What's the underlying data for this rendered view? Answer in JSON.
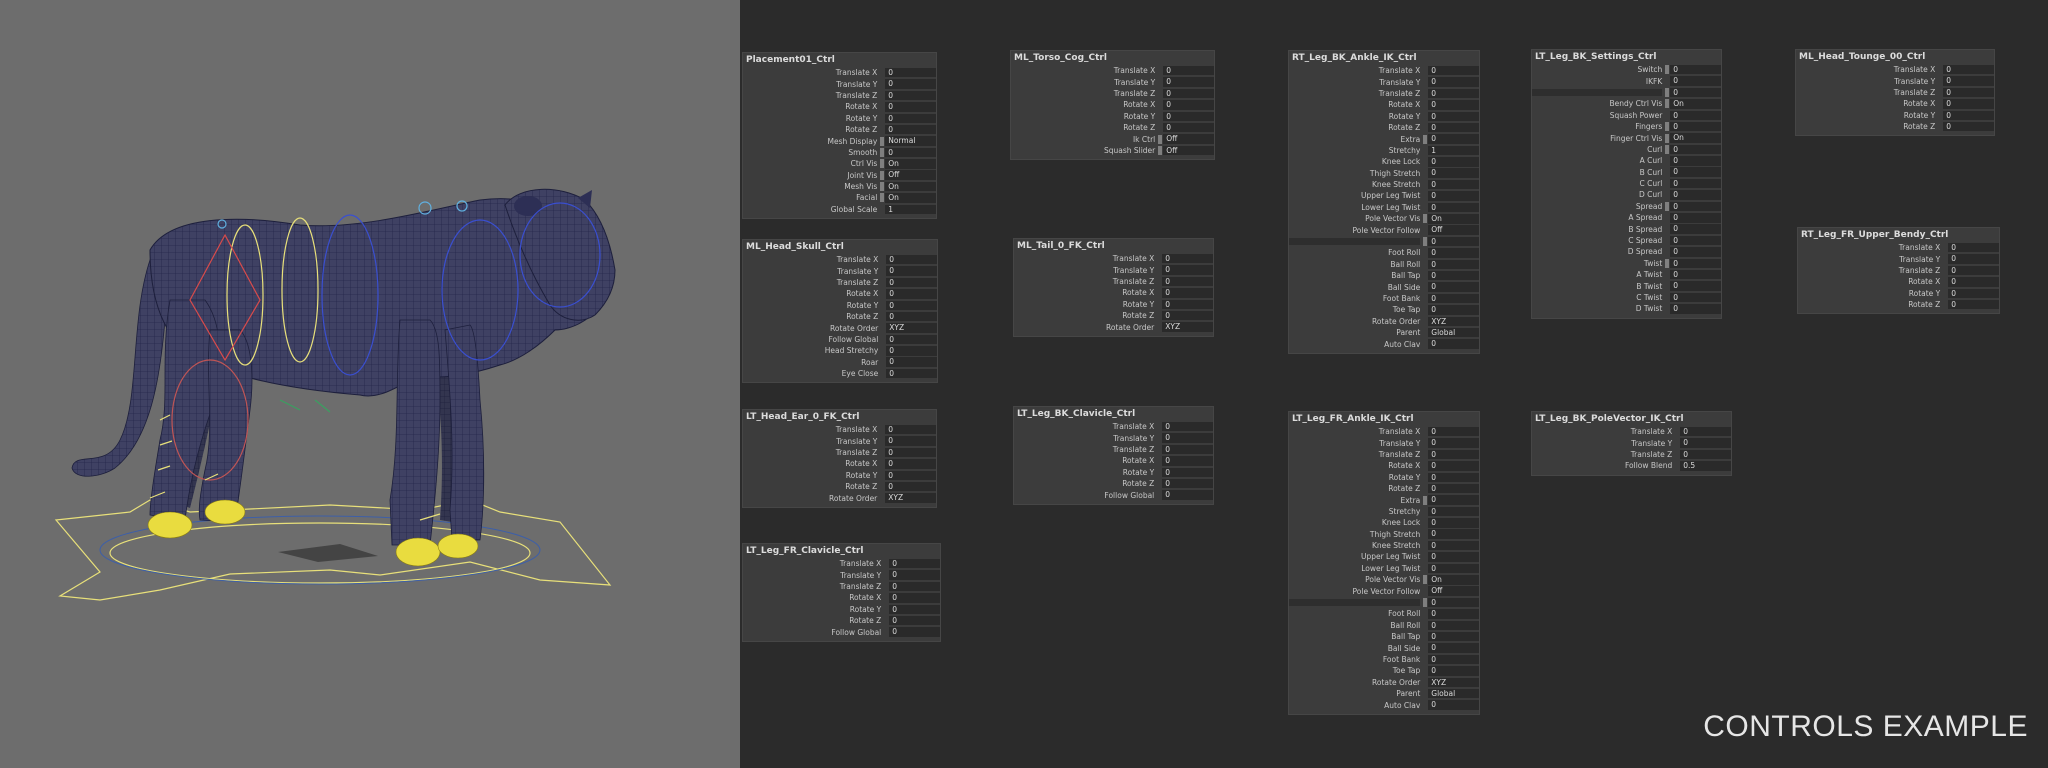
{
  "caption": "CONTROLS EXAMPLE",
  "boxes": {
    "placement": {
      "title": "Placement01_Ctrl",
      "rows": [
        {
          "label": "Translate X",
          "value": "0"
        },
        {
          "label": "Translate Y",
          "value": "0"
        },
        {
          "label": "Translate Z",
          "value": "0"
        },
        {
          "label": "Rotate X",
          "value": "0"
        },
        {
          "label": "Rotate Y",
          "value": "0"
        },
        {
          "label": "Rotate Z",
          "value": "0"
        },
        {
          "label": "Mesh Display",
          "value": "Normal"
        },
        {
          "label": "Smooth",
          "value": "0"
        },
        {
          "label": "Ctrl Vis",
          "value": "On"
        },
        {
          "label": "Joint Vis",
          "value": "Off"
        },
        {
          "label": "Mesh Vis",
          "value": "On"
        },
        {
          "label": "Facial",
          "value": "On"
        },
        {
          "label": "Global Scale",
          "value": "1"
        }
      ]
    },
    "torso_cog": {
      "title": "ML_Torso_Cog_Ctrl",
      "rows": [
        {
          "label": "Translate X",
          "value": "0"
        },
        {
          "label": "Translate Y",
          "value": "0"
        },
        {
          "label": "Translate Z",
          "value": "0"
        },
        {
          "label": "Rotate X",
          "value": "0"
        },
        {
          "label": "Rotate Y",
          "value": "0"
        },
        {
          "label": "Rotate Z",
          "value": "0"
        },
        {
          "label": "Ik Ctrl",
          "value": "Off"
        },
        {
          "label": "Squash Slider",
          "value": "Off"
        }
      ]
    },
    "rt_leg_bk_ankle": {
      "title": "RT_Leg_BK_Ankle_IK_Ctrl",
      "rows": [
        {
          "label": "Translate X",
          "value": "0"
        },
        {
          "label": "Translate Y",
          "value": "0"
        },
        {
          "label": "Translate Z",
          "value": "0"
        },
        {
          "label": "Rotate X",
          "value": "0"
        },
        {
          "label": "Rotate Y",
          "value": "0"
        },
        {
          "label": "Rotate Z",
          "value": "0"
        },
        {
          "label": "Extra",
          "value": "0"
        },
        {
          "label": "Stretchy",
          "value": "1"
        },
        {
          "label": "Knee Lock",
          "value": "0"
        },
        {
          "label": "Thigh Stretch",
          "value": "0"
        },
        {
          "label": "Knee Stretch",
          "value": "0"
        },
        {
          "label": "Upper Leg Twist",
          "value": "0"
        },
        {
          "label": "Lower Leg Twist",
          "value": "0"
        },
        {
          "label": "Pole Vector Vis",
          "value": "On"
        },
        {
          "label": "Pole Vector Follow",
          "value": "Off"
        },
        {
          "label": "",
          "value": "0"
        },
        {
          "label": "Foot Roll",
          "value": "0"
        },
        {
          "label": "Ball Roll",
          "value": "0"
        },
        {
          "label": "Ball Tap",
          "value": "0"
        },
        {
          "label": "Ball Side",
          "value": "0"
        },
        {
          "label": "Foot Bank",
          "value": "0"
        },
        {
          "label": "Toe Tap",
          "value": "0"
        },
        {
          "label": "Rotate Order",
          "value": "XYZ"
        },
        {
          "label": "Parent",
          "value": "Global"
        },
        {
          "label": "Auto Clav",
          "value": "0"
        }
      ]
    },
    "lt_leg_bk_settings": {
      "title": "LT_Leg_BK_Settings_Ctrl",
      "rows": [
        {
          "label": "Switch",
          "value": "0"
        },
        {
          "label": "IKFK",
          "value": "0"
        },
        {
          "label": "",
          "value": "0"
        },
        {
          "label": "Bendy Ctrl Vis",
          "value": "On"
        },
        {
          "label": "Squash Power",
          "value": "0"
        },
        {
          "label": "Fingers",
          "value": "0"
        },
        {
          "label": "Finger Ctrl Vis",
          "value": "On"
        },
        {
          "label": "Curl",
          "value": "0"
        },
        {
          "label": "A Curl",
          "value": "0"
        },
        {
          "label": "B Curl",
          "value": "0"
        },
        {
          "label": "C Curl",
          "value": "0"
        },
        {
          "label": "D Curl",
          "value": "0"
        },
        {
          "label": "Spread",
          "value": "0"
        },
        {
          "label": "A Spread",
          "value": "0"
        },
        {
          "label": "B Spread",
          "value": "0"
        },
        {
          "label": "C Spread",
          "value": "0"
        },
        {
          "label": "D Spread",
          "value": "0"
        },
        {
          "label": "Twist",
          "value": "0"
        },
        {
          "label": "A Twist",
          "value": "0"
        },
        {
          "label": "B Twist",
          "value": "0"
        },
        {
          "label": "C Twist",
          "value": "0"
        },
        {
          "label": "D Twist",
          "value": "0"
        }
      ]
    },
    "head_tounge": {
      "title": "ML_Head_Tounge_00_Ctrl",
      "rows": [
        {
          "label": "Translate X",
          "value": "0"
        },
        {
          "label": "Translate Y",
          "value": "0"
        },
        {
          "label": "Translate Z",
          "value": "0"
        },
        {
          "label": "Rotate X",
          "value": "0"
        },
        {
          "label": "Rotate Y",
          "value": "0"
        },
        {
          "label": "Rotate Z",
          "value": "0"
        }
      ]
    },
    "head_skull": {
      "title": "ML_Head_Skull_Ctrl",
      "rows": [
        {
          "label": "Translate X",
          "value": "0"
        },
        {
          "label": "Translate Y",
          "value": "0"
        },
        {
          "label": "Translate Z",
          "value": "0"
        },
        {
          "label": "Rotate X",
          "value": "0"
        },
        {
          "label": "Rotate Y",
          "value": "0"
        },
        {
          "label": "Rotate Z",
          "value": "0"
        },
        {
          "label": "Rotate Order",
          "value": "XYZ"
        },
        {
          "label": "Follow Global",
          "value": "0"
        },
        {
          "label": "Head Stretchy",
          "value": "0"
        },
        {
          "label": "Roar",
          "value": "0"
        },
        {
          "label": "Eye Close",
          "value": "0"
        }
      ]
    },
    "tail_fk": {
      "title": "ML_Tail_0_FK_Ctrl",
      "rows": [
        {
          "label": "Translate X",
          "value": "0"
        },
        {
          "label": "Translate Y",
          "value": "0"
        },
        {
          "label": "Translate Z",
          "value": "0"
        },
        {
          "label": "Rotate X",
          "value": "0"
        },
        {
          "label": "Rotate Y",
          "value": "0"
        },
        {
          "label": "Rotate Z",
          "value": "0"
        },
        {
          "label": "Rotate Order",
          "value": "XYZ"
        }
      ]
    },
    "rt_leg_fr_upper_bendy": {
      "title": "RT_Leg_FR_Upper_Bendy_Ctrl",
      "rows": [
        {
          "label": "Translate X",
          "value": "0"
        },
        {
          "label": "Translate Y",
          "value": "0"
        },
        {
          "label": "Translate Z",
          "value": "0"
        },
        {
          "label": "Rotate X",
          "value": "0"
        },
        {
          "label": "Rotate Y",
          "value": "0"
        },
        {
          "label": "Rotate Z",
          "value": "0"
        }
      ]
    },
    "lt_head_ear": {
      "title": "LT_Head_Ear_0_FK_Ctrl",
      "rows": [
        {
          "label": "Translate X",
          "value": "0"
        },
        {
          "label": "Translate Y",
          "value": "0"
        },
        {
          "label": "Translate Z",
          "value": "0"
        },
        {
          "label": "Rotate X",
          "value": "0"
        },
        {
          "label": "Rotate Y",
          "value": "0"
        },
        {
          "label": "Rotate Z",
          "value": "0"
        },
        {
          "label": "Rotate Order",
          "value": "XYZ"
        }
      ]
    },
    "lt_leg_bk_clavicle": {
      "title": "LT_Leg_BK_Clavicle_Ctrl",
      "rows": [
        {
          "label": "Translate X",
          "value": "0"
        },
        {
          "label": "Translate Y",
          "value": "0"
        },
        {
          "label": "Translate Z",
          "value": "0"
        },
        {
          "label": "Rotate X",
          "value": "0"
        },
        {
          "label": "Rotate Y",
          "value": "0"
        },
        {
          "label": "Rotate Z",
          "value": "0"
        },
        {
          "label": "Follow Global",
          "value": "0"
        }
      ]
    },
    "lt_leg_fr_ankle": {
      "title": "LT_Leg_FR_Ankle_IK_Ctrl",
      "rows": [
        {
          "label": "Translate X",
          "value": "0"
        },
        {
          "label": "Translate Y",
          "value": "0"
        },
        {
          "label": "Translate Z",
          "value": "0"
        },
        {
          "label": "Rotate X",
          "value": "0"
        },
        {
          "label": "Rotate Y",
          "value": "0"
        },
        {
          "label": "Rotate Z",
          "value": "0"
        },
        {
          "label": "Extra",
          "value": "0"
        },
        {
          "label": "Stretchy",
          "value": "0"
        },
        {
          "label": "Knee Lock",
          "value": "0"
        },
        {
          "label": "Thigh Stretch",
          "value": "0"
        },
        {
          "label": "Knee Stretch",
          "value": "0"
        },
        {
          "label": "Upper Leg Twist",
          "value": "0"
        },
        {
          "label": "Lower Leg Twist",
          "value": "0"
        },
        {
          "label": "Pole Vector Vis",
          "value": "On"
        },
        {
          "label": "Pole Vector Follow",
          "value": "Off"
        },
        {
          "label": "",
          "value": "0"
        },
        {
          "label": "Foot Roll",
          "value": "0"
        },
        {
          "label": "Ball Roll",
          "value": "0"
        },
        {
          "label": "Ball Tap",
          "value": "0"
        },
        {
          "label": "Ball Side",
          "value": "0"
        },
        {
          "label": "Foot Bank",
          "value": "0"
        },
        {
          "label": "Toe Tap",
          "value": "0"
        },
        {
          "label": "Rotate Order",
          "value": "XYZ"
        },
        {
          "label": "Parent",
          "value": "Global"
        },
        {
          "label": "Auto Clav",
          "value": "0"
        }
      ]
    },
    "lt_leg_bk_polevector": {
      "title": "LT_Leg_BK_PoleVector_IK_Ctrl",
      "rows": [
        {
          "label": "Translate X",
          "value": "0"
        },
        {
          "label": "Translate Y",
          "value": "0"
        },
        {
          "label": "Translate Z",
          "value": "0"
        },
        {
          "label": "Follow Blend",
          "value": "0.5"
        }
      ]
    },
    "lt_leg_fr_clavicle": {
      "title": "LT_Leg_FR_Clavicle_Ctrl",
      "rows": [
        {
          "label": "Translate X",
          "value": "0"
        },
        {
          "label": "Translate Y",
          "value": "0"
        },
        {
          "label": "Translate Z",
          "value": "0"
        },
        {
          "label": "Rotate X",
          "value": "0"
        },
        {
          "label": "Rotate Y",
          "value": "0"
        },
        {
          "label": "Rotate Z",
          "value": "0"
        },
        {
          "label": "Follow Global",
          "value": "0"
        }
      ]
    }
  }
}
